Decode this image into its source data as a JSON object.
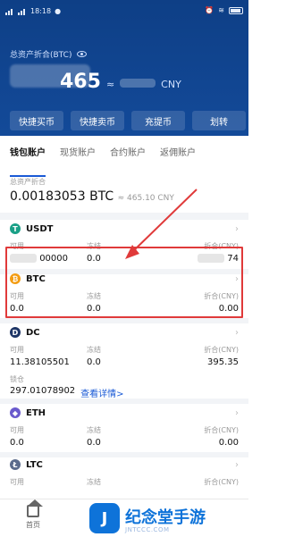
{
  "status_bar": {
    "time": "18:18"
  },
  "header": {
    "title": "总资产折合(BTC)",
    "balance_visible_part": "465",
    "approx_symbol": "≈",
    "currency": "CNY",
    "actions": [
      "快捷买币",
      "快捷卖币",
      "充提币",
      "划转"
    ]
  },
  "tabs": [
    "钱包账户",
    "现货账户",
    "合约账户",
    "返佣账户"
  ],
  "summary": {
    "label": "总资产折合",
    "btc_value": "0.00183053 BTC",
    "cny_value": "≈ 465.10 CNY"
  },
  "columns": {
    "available": "可用",
    "frozen": "冻结",
    "cny_equiv": "折合(CNY)"
  },
  "assets": [
    {
      "symbol": "USDT",
      "available_suffix": "00000",
      "frozen": "0.0",
      "cny_suffix": "74"
    },
    {
      "symbol": "BTC",
      "available": "0.0",
      "frozen": "0.0",
      "cny": "0.00"
    },
    {
      "symbol": "DC",
      "available": "11.38105501",
      "frozen": "0.0",
      "cny": "395.35",
      "locked_label": "锁仓",
      "locked_value": "297.01078902",
      "details_link": "查看详情>"
    },
    {
      "symbol": "ETH",
      "available": "0.0",
      "frozen": "0.0",
      "cny": "0.00"
    },
    {
      "symbol": "LTC",
      "available": "",
      "frozen": "",
      "cny": ""
    }
  ],
  "bottom_nav": {
    "home": "首页"
  },
  "watermark": {
    "brand": "纪念堂手游",
    "logo_letter": "J",
    "domain": "JNTCCC.COM"
  }
}
